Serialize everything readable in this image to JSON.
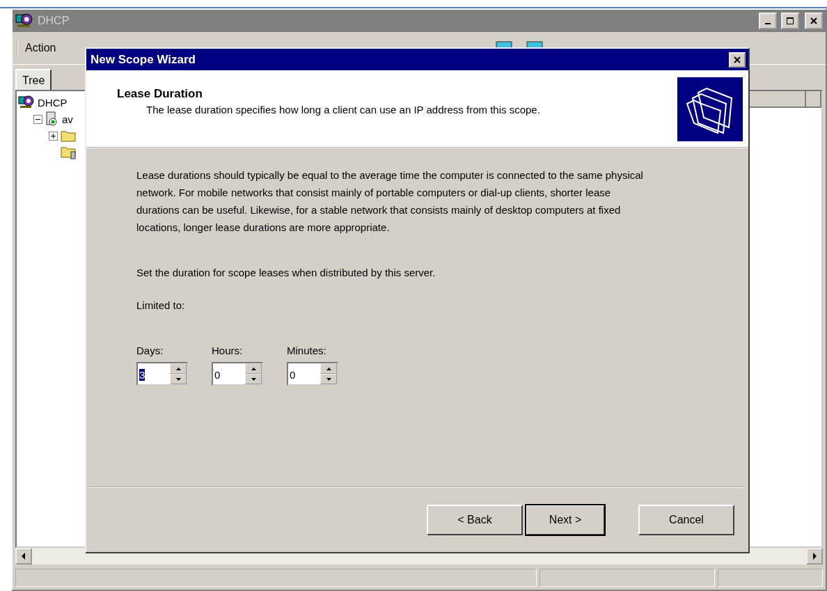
{
  "window": {
    "title": "DHCP"
  },
  "menu": [
    {
      "label": "Action"
    }
  ],
  "tabs": [
    {
      "label": "Tree",
      "selected": true
    }
  ],
  "tree": [
    {
      "label": "DHCP",
      "kind": "root",
      "children": [
        {
          "label": "av",
          "kind": "server",
          "expanded": true,
          "children": [
            {
              "kind": "folder",
              "expanded": false
            },
            {
              "kind": "folder-server"
            }
          ]
        }
      ]
    }
  ],
  "dialog": {
    "title": "New Scope Wizard",
    "header": {
      "title": "Lease Duration",
      "subtitle": "The lease duration specifies how long a client can use an IP address from this scope."
    },
    "paragraphs": [
      "Lease durations should typically be equal to the average time the computer is connected to the same physical network. For mobile networks that consist mainly of portable computers or dial-up clients, shorter lease durations can be useful. Likewise, for a stable network that consists mainly of desktop computers at fixed locations, longer lease durations are more appropriate.",
      "Set the duration for scope leases when distributed by this server.",
      "Limited to:"
    ],
    "fields": [
      {
        "label": "Days:",
        "value": "3",
        "text_selected": true
      },
      {
        "label": "Hours:",
        "value": "0",
        "text_selected": false
      },
      {
        "label": "Minutes:",
        "value": "0",
        "text_selected": false
      }
    ],
    "buttons": [
      {
        "label": "< Back",
        "default": false
      },
      {
        "label": "Next >",
        "default": true
      },
      {
        "label": "Cancel",
        "default": false
      }
    ]
  }
}
